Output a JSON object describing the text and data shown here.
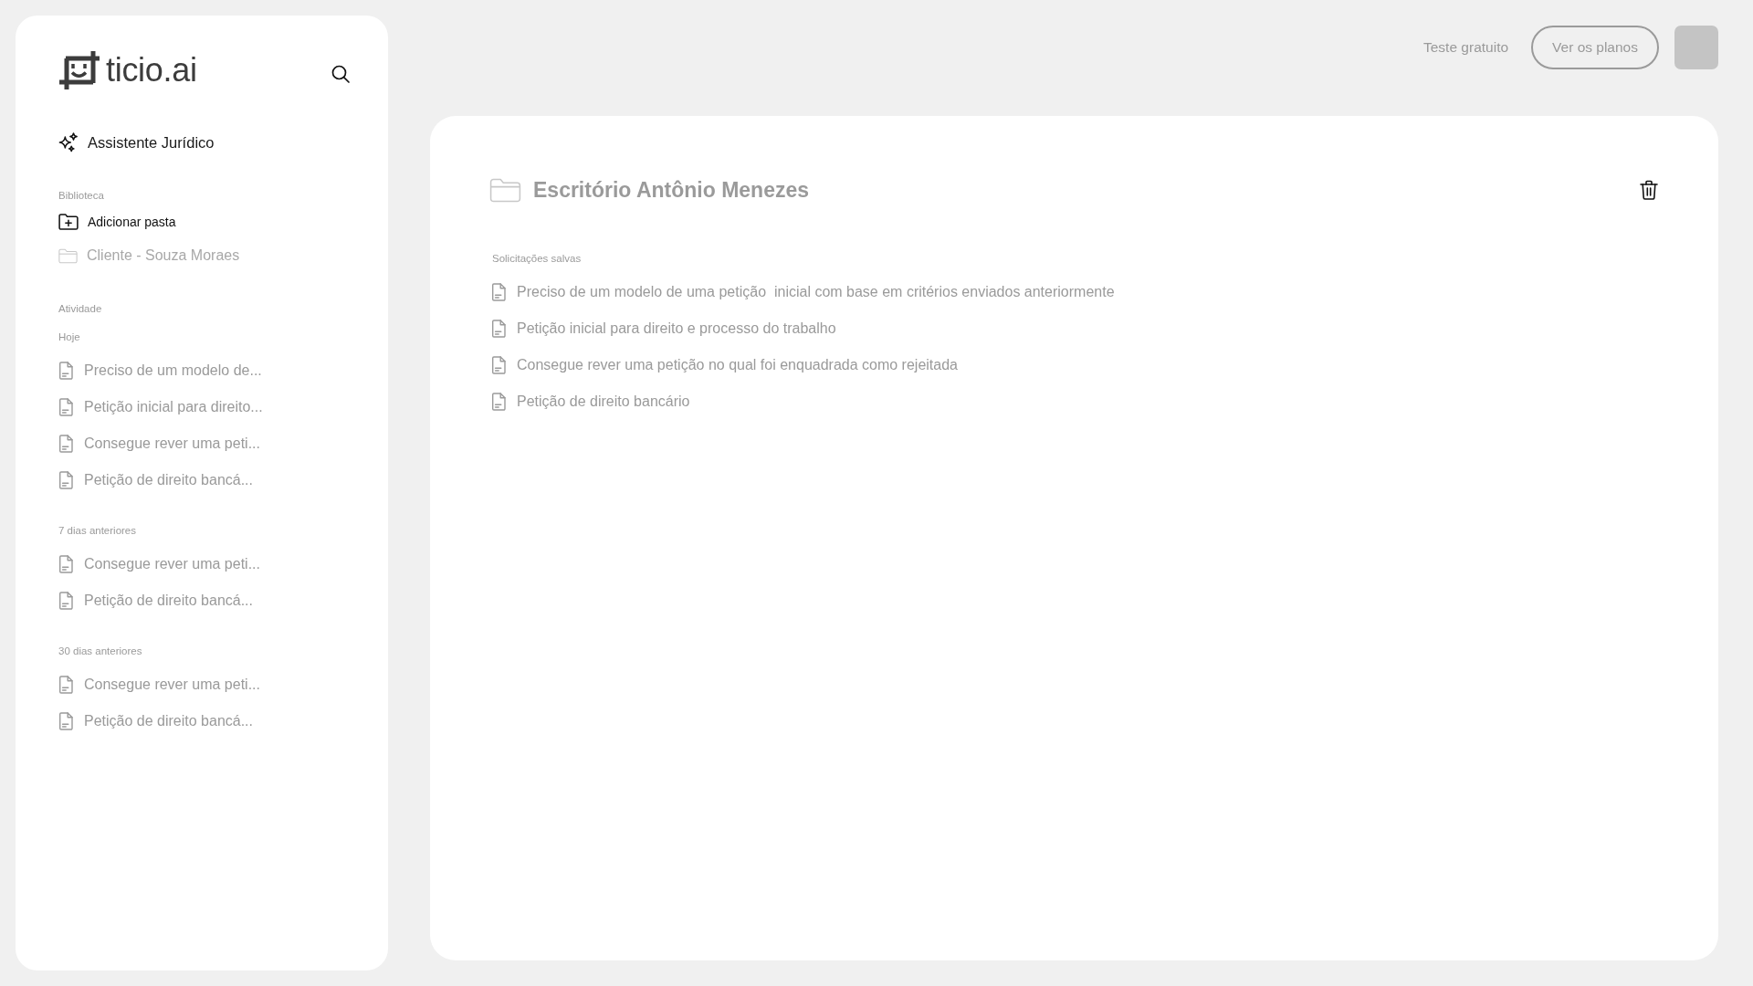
{
  "sidebar": {
    "logo_text": "ticio.ai",
    "assistant": "Assistente Jurídico",
    "library": {
      "heading": "Biblioteca",
      "add_folder": "Adicionar pasta",
      "folders": [
        "Cliente - Souza Moraes"
      ]
    },
    "activity": {
      "heading": "Atividade",
      "groups": [
        {
          "label": "Hoje",
          "items": [
            "Preciso de um modelo de...",
            "Petição inicial para direito...",
            "Consegue rever uma peti...",
            "Petição de direito bancá..."
          ]
        },
        {
          "label": "7 dias anteriores",
          "items": [
            "Consegue rever uma peti...",
            "Petição de direito bancá..."
          ]
        },
        {
          "label": "30 dias anteriores",
          "items": [
            "Consegue rever uma peti...",
            "Petição de direito bancá..."
          ]
        }
      ]
    }
  },
  "top_bar": {
    "trial_link": "Teste gratuito",
    "plans_button": "Ver os planos"
  },
  "folder": {
    "title": "Escritório Antônio Menezes",
    "section_label": "Solicitações salvas",
    "requests": [
      "Preciso de um modelo de uma petição  inicial com base em critérios enviados anteriormente",
      "Petição inicial para direito e processo do trabalho",
      "Consegue rever uma petição no qual foi enquadrada como rejeitada",
      "Petição de direito bancário"
    ]
  }
}
